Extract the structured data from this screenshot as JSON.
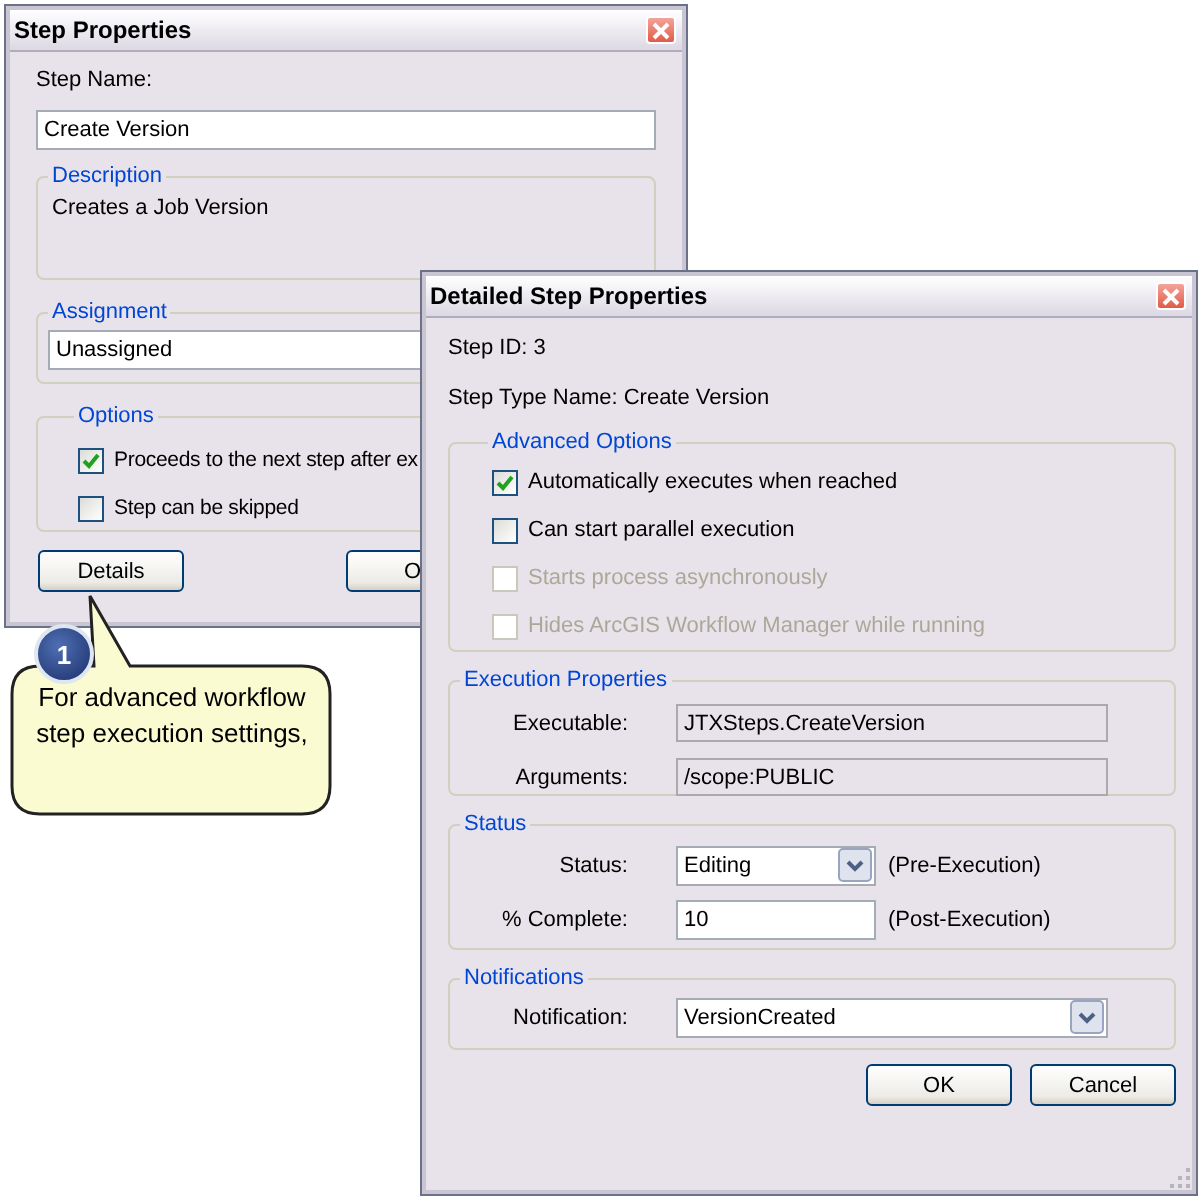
{
  "step_properties": {
    "title": "Step Properties",
    "step_name_label": "Step Name:",
    "step_name_value": "Create Version",
    "description": {
      "legend": "Description",
      "text": "Creates a Job Version"
    },
    "assignment": {
      "legend": "Assignment",
      "value": "Unassigned"
    },
    "options": {
      "legend": "Options",
      "items": [
        {
          "label": "Proceeds to the next step after ex",
          "checked": true
        },
        {
          "label": "Step can be skipped",
          "checked": false
        }
      ]
    },
    "buttons": [
      "Details",
      "O"
    ]
  },
  "detailed_step_properties": {
    "title": "Detailed Step Properties",
    "step_id": "Step ID: 3",
    "step_type": "Step Type Name: Create Version",
    "advanced_options": {
      "legend": "Advanced Options",
      "items": [
        {
          "label": "Automatically executes when reached",
          "checked": true,
          "disabled": false
        },
        {
          "label": "Can start parallel execution",
          "checked": false,
          "disabled": false
        },
        {
          "label": "Starts process asynchronously",
          "checked": false,
          "disabled": true
        },
        {
          "label": "Hides ArcGIS Workflow Manager while running",
          "checked": false,
          "disabled": true
        }
      ]
    },
    "execution_properties": {
      "legend": "Execution Properties",
      "fields": [
        {
          "label": "Executable:",
          "value": "JTXSteps.CreateVersion"
        },
        {
          "label": "Arguments:",
          "value": "/scope:PUBLIC"
        }
      ]
    },
    "status": {
      "legend": "Status",
      "rows": [
        {
          "kind": "dropdown",
          "label": "Status:",
          "value": "Editing",
          "note": "(Pre-Execution)"
        },
        {
          "kind": "input",
          "label": "% Complete:",
          "value": "10",
          "note": "(Post-Execution)"
        }
      ]
    },
    "notifications": {
      "legend": "Notifications",
      "label": "Notification:",
      "value": "VersionCreated"
    },
    "buttons": [
      "OK",
      "Cancel"
    ]
  },
  "callout": {
    "number": "1",
    "text": "For advanced workflow step execution settings,"
  }
}
